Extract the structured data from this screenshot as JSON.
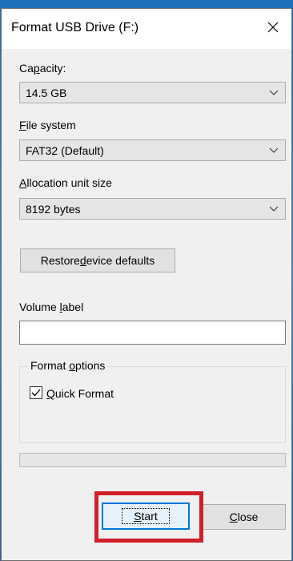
{
  "window": {
    "title": "Format USB Drive (F:)"
  },
  "capacity": {
    "label_pre": "Ca",
    "label_key": "p",
    "label_post": "acity:",
    "value": "14.5 GB"
  },
  "file_system": {
    "label_key": "F",
    "label_post": "ile system",
    "value": "FAT32 (Default)"
  },
  "allocation": {
    "label_key": "A",
    "label_post": "llocation unit size",
    "value": "8192 bytes"
  },
  "restore_button": {
    "label_pre": "Restore ",
    "label_key": "d",
    "label_post": "evice defaults"
  },
  "volume_label": {
    "label_pre": "Volume ",
    "label_key": "l",
    "label_post": "abel",
    "value": ""
  },
  "format_options": {
    "title_pre": "Format ",
    "title_key": "o",
    "title_post": "ptions",
    "quick_format": {
      "label_key": "Q",
      "label_post": "uick Format",
      "checked": true
    }
  },
  "progress": {
    "value": 0
  },
  "buttons": {
    "start_key": "S",
    "start_post": "tart",
    "close_key": "C",
    "close_post": "lose"
  },
  "colors": {
    "highlight": "#d0202a",
    "focus_border": "#0078d7"
  },
  "icons": {
    "close": "close-icon",
    "dropdown": "chevron-down-icon",
    "check": "checkmark-icon"
  }
}
